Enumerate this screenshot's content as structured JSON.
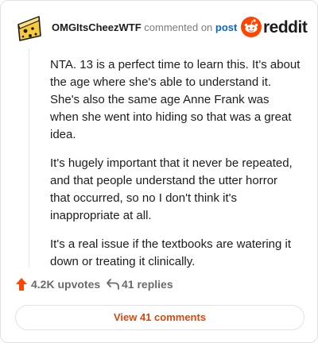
{
  "comment": {
    "username": "OMGItsCheezWTF",
    "action_text": "commented on",
    "link_text": "post",
    "paragraphs": [
      "NTA. 13 is a perfect time to learn this. It's about the age where she's able to understand it. She's also the same age Anne Frank was when she went into hiding so that was a great idea.",
      "It's hugely important that it never be repeated, and that people understand the utter horror that occurred, so no I don't think it's inappropriate at all.",
      "It's a real issue if the textbooks are watering it down or treating it clinically."
    ]
  },
  "brand": {
    "name": "reddit",
    "accent_color": "#ff4500"
  },
  "footer": {
    "upvotes_label": "4.2K upvotes",
    "replies_label": "41 replies",
    "view_button_label": "View 41 comments"
  },
  "icons": {
    "avatar": "cheese-avatar-icon",
    "brand_logo": "reddit-snoo-icon",
    "upvote": "upvote-arrow-icon",
    "reply": "reply-arrow-icon"
  }
}
